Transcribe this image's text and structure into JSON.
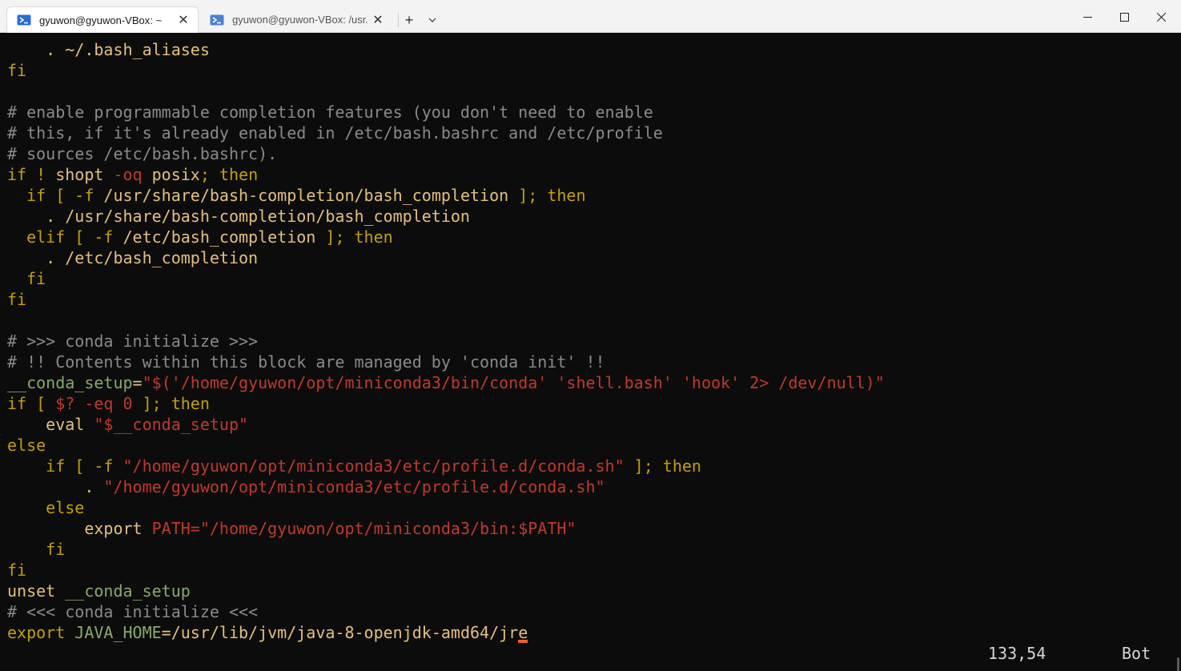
{
  "window": {
    "tabs": [
      {
        "title": "gyuwon@gyuwon-VBox: ~",
        "active": true
      },
      {
        "title": "gyuwon@gyuwon-VBox: /usr/l",
        "active": false
      }
    ],
    "new_tab_label": "+",
    "dropdown_icon": "chevron-down-icon"
  },
  "colors": {
    "comment": "#8a8a8a",
    "keyword": "#c4a000",
    "identifier": "#e5c07b",
    "string": "#c0392b",
    "variable": "#87a96b",
    "plain": "#d7d7d7",
    "cursor": "#f0621f"
  },
  "lines": [
    [
      {
        "t": "    . ~/.bash_aliases",
        "c": "identifier"
      }
    ],
    [
      {
        "t": "fi",
        "c": "keyword"
      }
    ],
    [
      {
        "t": "",
        "c": "plain"
      }
    ],
    [
      {
        "t": "# enable programmable completion features (you don't need to enable",
        "c": "comment"
      }
    ],
    [
      {
        "t": "# this, if it's already enabled in /etc/bash.bashrc and /etc/profile",
        "c": "comment"
      }
    ],
    [
      {
        "t": "# sources /etc/bash.bashrc).",
        "c": "comment"
      }
    ],
    [
      {
        "t": "if ! ",
        "c": "keyword"
      },
      {
        "t": "shopt ",
        "c": "identifier"
      },
      {
        "t": "-oq ",
        "c": "string"
      },
      {
        "t": "posix",
        "c": "identifier"
      },
      {
        "t": "; then",
        "c": "keyword"
      }
    ],
    [
      {
        "t": "  if [ -f ",
        "c": "keyword"
      },
      {
        "t": "/usr/share/bash-completion/bash_completion",
        "c": "identifier"
      },
      {
        "t": " ]; then",
        "c": "keyword"
      }
    ],
    [
      {
        "t": "    . /usr/share/bash-completion/bash_completion",
        "c": "identifier"
      }
    ],
    [
      {
        "t": "  elif [ -f ",
        "c": "keyword"
      },
      {
        "t": "/etc/bash_completion",
        "c": "identifier"
      },
      {
        "t": " ]; then",
        "c": "keyword"
      }
    ],
    [
      {
        "t": "    . /etc/bash_completion",
        "c": "identifier"
      }
    ],
    [
      {
        "t": "  fi",
        "c": "keyword"
      }
    ],
    [
      {
        "t": "fi",
        "c": "keyword"
      }
    ],
    [
      {
        "t": "",
        "c": "plain"
      }
    ],
    [
      {
        "t": "# >>> conda initialize >>>",
        "c": "comment"
      }
    ],
    [
      {
        "t": "# !! Contents within this block are managed by 'conda init' !!",
        "c": "comment"
      }
    ],
    [
      {
        "t": "__conda_setup",
        "c": "variable"
      },
      {
        "t": "=",
        "c": "identifier"
      },
      {
        "t": "\"$('/home/gyuwon/opt/miniconda3/bin/conda' 'shell.bash' 'hook' 2> /dev/null)\"",
        "c": "string"
      }
    ],
    [
      {
        "t": "if [ ",
        "c": "keyword"
      },
      {
        "t": "$? -eq 0",
        "c": "string"
      },
      {
        "t": " ]; then",
        "c": "keyword"
      }
    ],
    [
      {
        "t": "    eval ",
        "c": "identifier"
      },
      {
        "t": "\"$__conda_setup\"",
        "c": "string"
      }
    ],
    [
      {
        "t": "else",
        "c": "keyword"
      }
    ],
    [
      {
        "t": "    if [ -f ",
        "c": "keyword"
      },
      {
        "t": "\"/home/gyuwon/opt/miniconda3/etc/profile.d/conda.sh\"",
        "c": "string"
      },
      {
        "t": " ]; then",
        "c": "keyword"
      }
    ],
    [
      {
        "t": "        . ",
        "c": "identifier"
      },
      {
        "t": "\"/home/gyuwon/opt/miniconda3/etc/profile.d/conda.sh\"",
        "c": "string"
      }
    ],
    [
      {
        "t": "    else",
        "c": "keyword"
      }
    ],
    [
      {
        "t": "        export ",
        "c": "identifier"
      },
      {
        "t": "PATH=",
        "c": "string"
      },
      {
        "t": "\"/home/gyuwon/opt/miniconda3/bin:$PATH\"",
        "c": "string"
      }
    ],
    [
      {
        "t": "    fi",
        "c": "keyword"
      }
    ],
    [
      {
        "t": "fi",
        "c": "keyword"
      }
    ],
    [
      {
        "t": "unset ",
        "c": "identifier"
      },
      {
        "t": "__conda_setup",
        "c": "variable"
      }
    ],
    [
      {
        "t": "# <<< conda initialize <<<",
        "c": "comment"
      }
    ],
    [
      {
        "t": "export ",
        "c": "keyword"
      },
      {
        "t": "JAVA_HOME",
        "c": "variable"
      },
      {
        "t": "=/usr/lib/jvm/java-8-openjdk-amd64/jr",
        "c": "identifier"
      },
      {
        "t": "e",
        "c": "identifier",
        "cursor": true
      }
    ]
  ],
  "status": {
    "position": "133,54",
    "scroll": "Bot"
  }
}
